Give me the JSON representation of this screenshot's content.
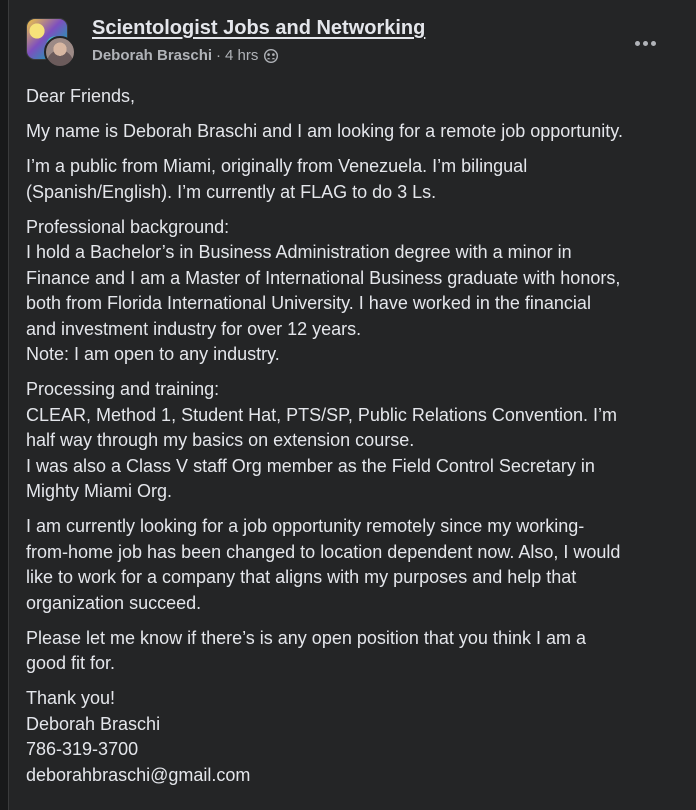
{
  "post": {
    "group_name": "Scientologist Jobs and Networking",
    "author": "Deborah Braschi",
    "separator": "·",
    "time": "4 hrs",
    "privacy_icon": "group-members-icon",
    "more_icon": "more-options-icon",
    "paragraphs": [
      "Dear Friends,",
      "My name is Deborah Braschi and I am looking for a remote job opportunity.",
      "I’m a public from Miami, originally from Venezuela. I’m bilingual\n(Spanish/English). I’m currently at FLAG to do 3 Ls.",
      "Professional background:\nI hold a Bachelor’s in Business Administration degree with a minor in\nFinance and I am a Master of International Business graduate with honors,\nboth from Florida International University. I have worked in the financial\nand investment industry for over 12 years.\nNote: I am open to any industry.",
      "Processing and training:\nCLEAR, Method 1, Student Hat, PTS/SP, Public Relations Convention. I’m\nhalf way through my basics on extension course.\nI was also a Class V staff Org member as the Field Control Secretary in\nMighty Miami Org.",
      "I am currently looking for a job opportunity remotely since my working-\nfrom-home job has been changed to location dependent now. Also, I would\nlike to work for a company that aligns with my purposes and help that\norganization succeed.",
      "Please let me know if there’s is any open position  that you think I am a\ngood fit for.",
      "Thank you!\nDeborah Braschi\n786-319-3700\ndeborahbraschi@gmail.com"
    ]
  },
  "colors": {
    "page_bg": "#18191a",
    "card_bg": "#242526",
    "primary_text": "#e4e6eb",
    "secondary_text": "#b0b3b8"
  }
}
